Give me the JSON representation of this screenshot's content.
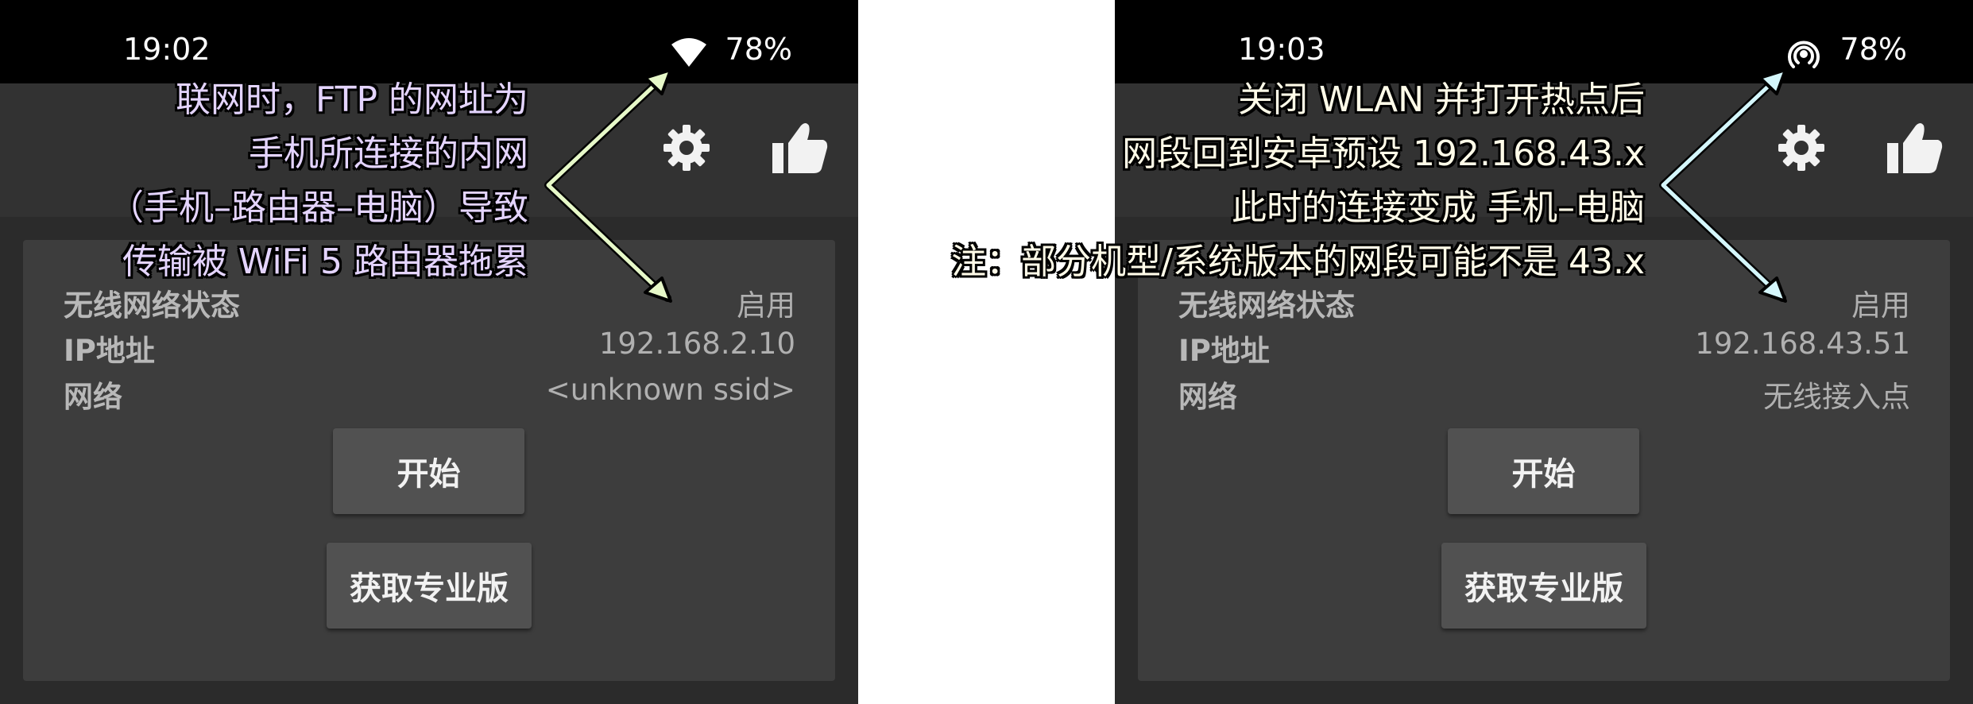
{
  "left_screen": {
    "status_bar": {
      "time": "19:02",
      "battery": "78%",
      "network_icon": "wifi-icon"
    },
    "app_bar": {
      "icons": [
        "settings-gear-icon",
        "thumbs-up-icon"
      ]
    },
    "info": {
      "wireless_status_label": "无线网络状态",
      "wireless_status_value": "启用",
      "ip_label": "IP地址",
      "ip_value": "192.168.2.10",
      "network_label": "网络",
      "network_value": "<unknown ssid>"
    },
    "buttons": {
      "start": "开始",
      "get_pro": "获取专业版"
    }
  },
  "right_screen": {
    "status_bar": {
      "time": "19:03",
      "battery": "78%",
      "network_icon": "hotspot-icon"
    },
    "app_bar": {
      "icons": [
        "settings-gear-icon",
        "thumbs-up-icon"
      ]
    },
    "info": {
      "wireless_status_label": "无线网络状态",
      "wireless_status_value": "启用",
      "ip_label": "IP地址",
      "ip_value": "192.168.43.51",
      "network_label": "网络",
      "network_value": "无线接入点"
    },
    "buttons": {
      "start": "开始",
      "get_pro": "获取专业版"
    }
  },
  "annotations": {
    "left_lines": [
      "联网时，FTP 的网址为",
      "手机所连接的内网",
      "（手机–路由器–电脑）导致",
      "传输被 WiFi 5 路由器拖累"
    ],
    "right_lines": [
      "关闭 WLAN 并打开热点后",
      "网段回到安卓预设 192.168.43.x",
      "此时的连接变成 手机–电脑",
      "注：部分机型/系统版本的网段可能不是 43.x"
    ],
    "colors": {
      "left_text": "#e4d4ff",
      "left_arrow": "#e6f8c8",
      "right_text": "#fffbe8",
      "right_arrow": "#d4f6fb"
    }
  },
  "colors": {
    "status_bar": "#000000",
    "app_bar": "#323232",
    "screen_bg": "#2b2b2b",
    "card": "#3d3d3d",
    "button": "#515151"
  }
}
